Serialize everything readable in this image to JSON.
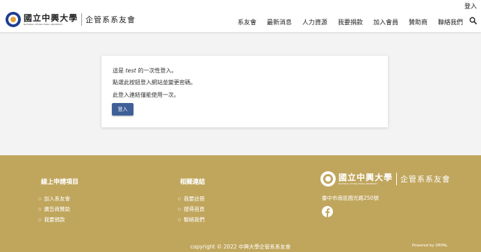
{
  "header": {
    "login_link": "登入",
    "logo": {
      "school_name": "國立中興大學",
      "school_english": "NATIONAL CHUNG HSING UNIVERSITY",
      "dept_name": "企管系系友會"
    },
    "nav": [
      "系友會",
      "最新消息",
      "人力資源",
      "我要捐款",
      "加入會員",
      "贊助商",
      "聯絡我們"
    ],
    "search_icon": "search-icon"
  },
  "card": {
    "line1_prefix": "這是 ",
    "line1_em": "test",
    "line1_suffix": " 的一次性登入。",
    "line2": "點選此按鈕登入網站並變更密碼。",
    "line3": "此登入連結僅能使用一次。",
    "button": "登入",
    "button_color": "#3f5f97"
  },
  "footer": {
    "bg_color": "#c0a65d",
    "col1": {
      "title": "線上申請項目",
      "links": [
        "加入系友會",
        "廣告商贊助",
        "我要捐款"
      ]
    },
    "col2": {
      "title": "相關連結",
      "links": [
        "我要註冊",
        "搜尋首頁",
        "聯絡我們"
      ]
    },
    "address": "臺中市南區國光路250號",
    "social_icon": "facebook-icon",
    "copyright": "copyright © 2022 中興大學企管系系友會",
    "powered": "Powered by DEPAL"
  }
}
